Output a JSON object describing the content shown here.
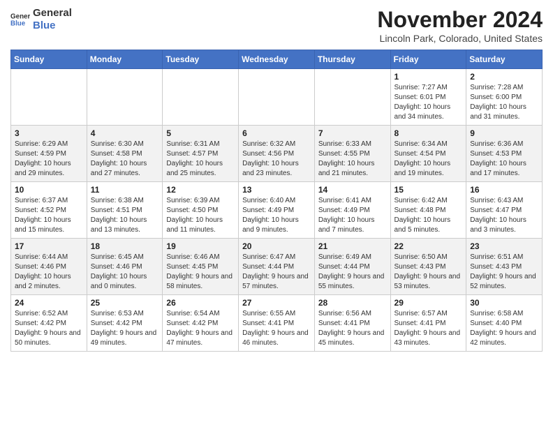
{
  "header": {
    "logo_line1": "General",
    "logo_line2": "Blue",
    "month": "November 2024",
    "location": "Lincoln Park, Colorado, United States"
  },
  "weekdays": [
    "Sunday",
    "Monday",
    "Tuesday",
    "Wednesday",
    "Thursday",
    "Friday",
    "Saturday"
  ],
  "weeks": [
    [
      {
        "day": "",
        "info": ""
      },
      {
        "day": "",
        "info": ""
      },
      {
        "day": "",
        "info": ""
      },
      {
        "day": "",
        "info": ""
      },
      {
        "day": "",
        "info": ""
      },
      {
        "day": "1",
        "info": "Sunrise: 7:27 AM\nSunset: 6:01 PM\nDaylight: 10 hours and 34 minutes."
      },
      {
        "day": "2",
        "info": "Sunrise: 7:28 AM\nSunset: 6:00 PM\nDaylight: 10 hours and 31 minutes."
      }
    ],
    [
      {
        "day": "3",
        "info": "Sunrise: 6:29 AM\nSunset: 4:59 PM\nDaylight: 10 hours and 29 minutes."
      },
      {
        "day": "4",
        "info": "Sunrise: 6:30 AM\nSunset: 4:58 PM\nDaylight: 10 hours and 27 minutes."
      },
      {
        "day": "5",
        "info": "Sunrise: 6:31 AM\nSunset: 4:57 PM\nDaylight: 10 hours and 25 minutes."
      },
      {
        "day": "6",
        "info": "Sunrise: 6:32 AM\nSunset: 4:56 PM\nDaylight: 10 hours and 23 minutes."
      },
      {
        "day": "7",
        "info": "Sunrise: 6:33 AM\nSunset: 4:55 PM\nDaylight: 10 hours and 21 minutes."
      },
      {
        "day": "8",
        "info": "Sunrise: 6:34 AM\nSunset: 4:54 PM\nDaylight: 10 hours and 19 minutes."
      },
      {
        "day": "9",
        "info": "Sunrise: 6:36 AM\nSunset: 4:53 PM\nDaylight: 10 hours and 17 minutes."
      }
    ],
    [
      {
        "day": "10",
        "info": "Sunrise: 6:37 AM\nSunset: 4:52 PM\nDaylight: 10 hours and 15 minutes."
      },
      {
        "day": "11",
        "info": "Sunrise: 6:38 AM\nSunset: 4:51 PM\nDaylight: 10 hours and 13 minutes."
      },
      {
        "day": "12",
        "info": "Sunrise: 6:39 AM\nSunset: 4:50 PM\nDaylight: 10 hours and 11 minutes."
      },
      {
        "day": "13",
        "info": "Sunrise: 6:40 AM\nSunset: 4:49 PM\nDaylight: 10 hours and 9 minutes."
      },
      {
        "day": "14",
        "info": "Sunrise: 6:41 AM\nSunset: 4:49 PM\nDaylight: 10 hours and 7 minutes."
      },
      {
        "day": "15",
        "info": "Sunrise: 6:42 AM\nSunset: 4:48 PM\nDaylight: 10 hours and 5 minutes."
      },
      {
        "day": "16",
        "info": "Sunrise: 6:43 AM\nSunset: 4:47 PM\nDaylight: 10 hours and 3 minutes."
      }
    ],
    [
      {
        "day": "17",
        "info": "Sunrise: 6:44 AM\nSunset: 4:46 PM\nDaylight: 10 hours and 2 minutes."
      },
      {
        "day": "18",
        "info": "Sunrise: 6:45 AM\nSunset: 4:46 PM\nDaylight: 10 hours and 0 minutes."
      },
      {
        "day": "19",
        "info": "Sunrise: 6:46 AM\nSunset: 4:45 PM\nDaylight: 9 hours and 58 minutes."
      },
      {
        "day": "20",
        "info": "Sunrise: 6:47 AM\nSunset: 4:44 PM\nDaylight: 9 hours and 57 minutes."
      },
      {
        "day": "21",
        "info": "Sunrise: 6:49 AM\nSunset: 4:44 PM\nDaylight: 9 hours and 55 minutes."
      },
      {
        "day": "22",
        "info": "Sunrise: 6:50 AM\nSunset: 4:43 PM\nDaylight: 9 hours and 53 minutes."
      },
      {
        "day": "23",
        "info": "Sunrise: 6:51 AM\nSunset: 4:43 PM\nDaylight: 9 hours and 52 minutes."
      }
    ],
    [
      {
        "day": "24",
        "info": "Sunrise: 6:52 AM\nSunset: 4:42 PM\nDaylight: 9 hours and 50 minutes."
      },
      {
        "day": "25",
        "info": "Sunrise: 6:53 AM\nSunset: 4:42 PM\nDaylight: 9 hours and 49 minutes."
      },
      {
        "day": "26",
        "info": "Sunrise: 6:54 AM\nSunset: 4:42 PM\nDaylight: 9 hours and 47 minutes."
      },
      {
        "day": "27",
        "info": "Sunrise: 6:55 AM\nSunset: 4:41 PM\nDaylight: 9 hours and 46 minutes."
      },
      {
        "day": "28",
        "info": "Sunrise: 6:56 AM\nSunset: 4:41 PM\nDaylight: 9 hours and 45 minutes."
      },
      {
        "day": "29",
        "info": "Sunrise: 6:57 AM\nSunset: 4:41 PM\nDaylight: 9 hours and 43 minutes."
      },
      {
        "day": "30",
        "info": "Sunrise: 6:58 AM\nSunset: 4:40 PM\nDaylight: 9 hours and 42 minutes."
      }
    ]
  ]
}
